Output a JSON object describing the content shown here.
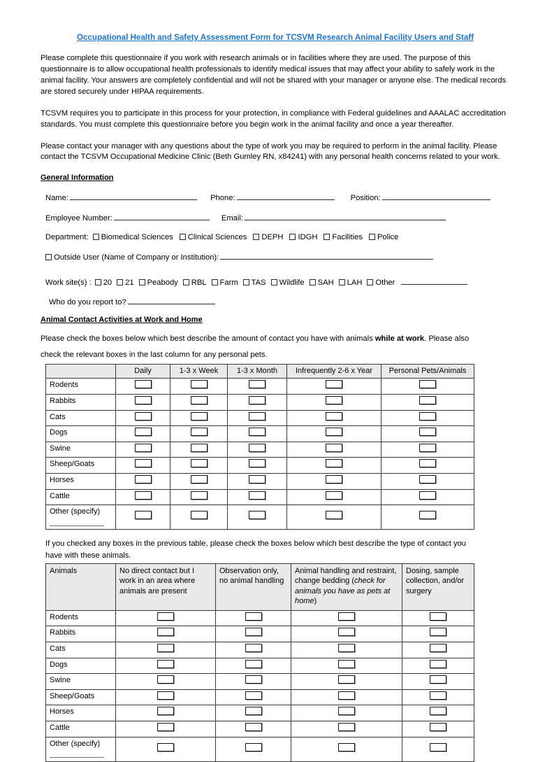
{
  "document": {
    "title": "Occupational Health and Safety Assessment Form for TCSVM Research Animal Facility Users and Staff",
    "title_color": "#1F76C8",
    "paragraphs": [
      "Please complete this questionnaire if you work with research animals or in facilities where they are used. The purpose of this questionnaire is to allow occupational health professionals to identify medical issues that may affect your ability to safely work in the animal facility. Your answers are completely confidential and will not be shared with your manager or anyone else. The medical records are stored securely under HIPAA requirements.",
      "TCSVM requires you to participate in this process for your protection, in compliance with Federal guidelines and AAALAC accreditation standards.   You must complete this questionnaire before you begin work in the animal facility and once a year thereafter.",
      "Please contact your manager with any questions about the type of work you may be required to perform in the animal facility. Please contact the TCSVM Occupational Medicine Clinic (Beth Gumley RN, x84241) with any personal health concerns related to your work."
    ]
  },
  "general_information": {
    "heading": "General Information",
    "row1": {
      "name_label": "Name:",
      "phone_label": "Phone:",
      "position_label": "Position:"
    },
    "row2": {
      "employee_number_label": "Employee Number:",
      "email_label": "Email:"
    },
    "department": {
      "label": "Department:",
      "options": [
        "Biomedical Sciences",
        "Clinical Sciences",
        "DEPH",
        "IDGH",
        "Facilities",
        "Police"
      ]
    },
    "outside_user": {
      "label": "Outside User (Name of Company or Institution):"
    },
    "work_site": {
      "label": "Work site(s) :",
      "options": [
        "20",
        "21",
        "Peabody",
        "RBL",
        "Farm",
        "TAS",
        "Wildlife",
        "SAH",
        "LAH",
        "Other"
      ]
    },
    "report_to": {
      "label": "Who do you report to?"
    }
  },
  "animal_contact": {
    "heading": "Animal Contact Activities at Work and Home",
    "intro_line1_a": "Please check the boxes below which best describe the amount of contact you have with animals ",
    "intro_line1_bold": "while at work",
    "intro_line1_b": ". Please also",
    "intro_line2": "check the relevant boxes in the last column for any personal pets.",
    "frequency_table": {
      "columns": [
        "",
        "Daily",
        "1-3 x Week",
        "1-3 x Month",
        "Infrequently 2-6 x Year",
        "Personal Pets/Animals"
      ],
      "rows": [
        "Rodents",
        "Rabbits",
        "Cats",
        "Dogs",
        "Swine",
        "Sheep/Goats",
        "Horses",
        "Cattle",
        "Other (specify)"
      ]
    },
    "contact_intro": "If you checked any boxes in the previous table, please check the boxes below which best describe the type of contact you have with these animals.",
    "contact_table": {
      "columns": [
        {
          "label": "Animals"
        },
        {
          "label": "No direct contact but I work in an area where animals are present"
        },
        {
          "label": "Observation only, no animal handling"
        },
        {
          "label_a": "Animal handling and restraint, change bedding (",
          "label_italic": "check for animals you have as pets at home",
          "label_b": ")"
        },
        {
          "label": "Dosing, sample collection, and/or surgery"
        }
      ],
      "rows": [
        "Rodents",
        "Rabbits",
        "Cats",
        "Dogs",
        "Swine",
        "Sheep/Goats",
        "Horses",
        "Cattle",
        "Other (specify)"
      ]
    }
  }
}
